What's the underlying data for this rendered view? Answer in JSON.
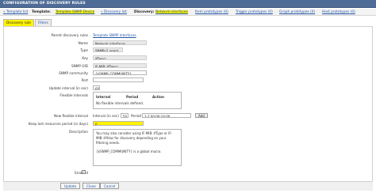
{
  "window": {
    "title": "CONFIGURATION OF DISCOVERY RULES"
  },
  "breadcrumbs": {
    "template_list": "« Template list",
    "template_label": "Template:",
    "template_name": "Template SNMP Device",
    "discovery_list": "« Discovery list",
    "discovery_label": "Discovery:",
    "discovery_name": "Network interfaces",
    "item_prototypes": "Item prototypes",
    "item_prototypes_count": "(0)",
    "trigger_prototypes": "Trigger prototypes",
    "trigger_prototypes_count": "(0)",
    "graph_prototypes": "Graph prototypes",
    "graph_prototypes_count": "(0)",
    "host_prototypes": "Host prototypes",
    "host_prototypes_count": "(0)"
  },
  "tabs": [
    {
      "label": "Discovery rule",
      "active": true
    },
    {
      "label": "Filters",
      "active": false
    }
  ],
  "form": {
    "parent_label": "Parent discovery rules",
    "parent_value": "Template SNMP Interfaces",
    "name_label": "Name",
    "name_value": "Network interfaces",
    "type_label": "Type",
    "type_value": "SNMPv2 agent",
    "key_label": "Key",
    "key_value": "ifDescr",
    "oid_label": "SNMP OID",
    "oid_value": "IF-MIB::ifDescr",
    "community_label": "SNMP community",
    "community_value": "{$SNMP_COMMUNITY}",
    "port_label": "Port",
    "port_value": "",
    "update_label": "Update interval (in sec)",
    "update_value": "60",
    "flex_label": "Flexible intervals",
    "flex_headers": [
      "Interval",
      "Period",
      "Action"
    ],
    "flex_empty": "No flexible intervals defined.",
    "new_flex_label": "New flexible interval",
    "new_interval_label": "Interval (in sec)",
    "new_interval_value": "50",
    "new_period_label": "Period",
    "new_period_value": "1-7,00:00-24:00",
    "add_button": "Add",
    "lost_label": "Keep lost resources period (in days)",
    "lost_value": "0",
    "description_label": "Description",
    "description_value": "You may also consider using IF-MIB::ifType or IF-MIB::ifAlias for discovery depending on your filtering needs.\n\n{$SNMP_COMMUNITY} is a global macro.",
    "enabled_label": "Enabled",
    "enabled_mark": "✓"
  },
  "footer": {
    "update_button": "Update",
    "clone_button": "Clone",
    "cancel_button": "Cancel"
  },
  "colors": {
    "titlebar": "#4e6c96",
    "highlight": "#fff200",
    "link": "#2356a8"
  }
}
